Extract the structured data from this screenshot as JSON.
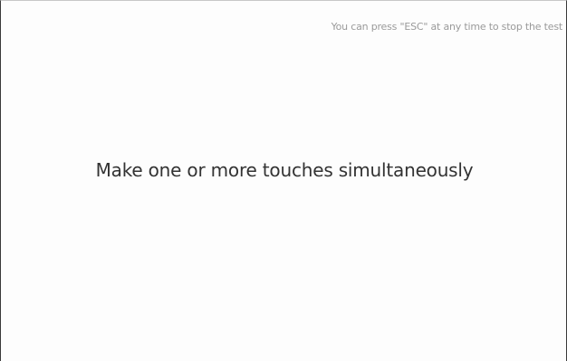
{
  "hint": {
    "esc_text": "You can press \"ESC\" at any time to stop the test"
  },
  "main": {
    "instruction": "Make one or more touches simultaneously"
  }
}
